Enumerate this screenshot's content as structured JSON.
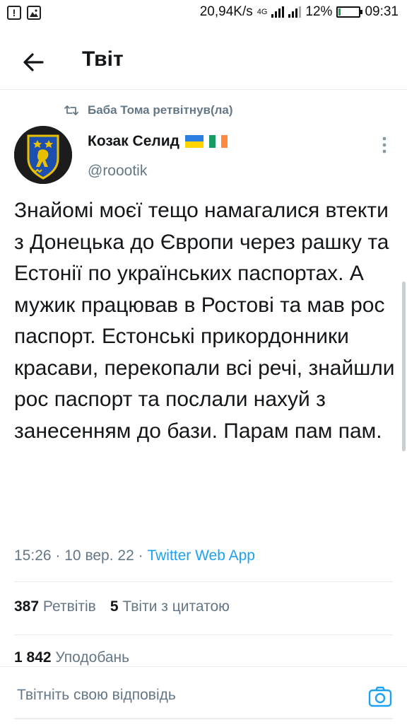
{
  "status_bar": {
    "speed": "20,94K/s",
    "network": "4G",
    "battery": "12%",
    "battery_level": 0.12,
    "time": "09:31"
  },
  "header": {
    "title": "Твіт"
  },
  "retweet": {
    "text": "Баба Тома ретвітнув(ла)"
  },
  "author": {
    "name": "Козак Селид",
    "handle": "@roootik",
    "flags": [
      "ukraine-flag-icon",
      "ireland-flag-icon"
    ]
  },
  "tweet": {
    "text": "Знайомі моєї тещо намагалися втекти з Донецька до Європи через рашку та Естонії по українських паспортах. А мужик працював в Ростові та мав рос паспорт. Естонські прикордонники красави, перекопали всі речі, знайшли рос паспорт та послали нахуй з занесенням до бази. Парам пам пам.",
    "time": "15:26",
    "separator": "·",
    "date": "10 вер. 22",
    "source": "Twitter Web App"
  },
  "stats": {
    "retweets_count": "387",
    "retweets_label": "Ретвітів",
    "quotes_count": "5",
    "quotes_label": "Твіти з цитатою",
    "likes_count": "1 842",
    "likes_label": "Уподобань"
  },
  "reply": {
    "placeholder": "Твітніть свою відповідь"
  },
  "colors": {
    "accent": "#1da1f2",
    "muted": "#657786",
    "text": "#14171a",
    "divider": "#e6ecf0"
  }
}
